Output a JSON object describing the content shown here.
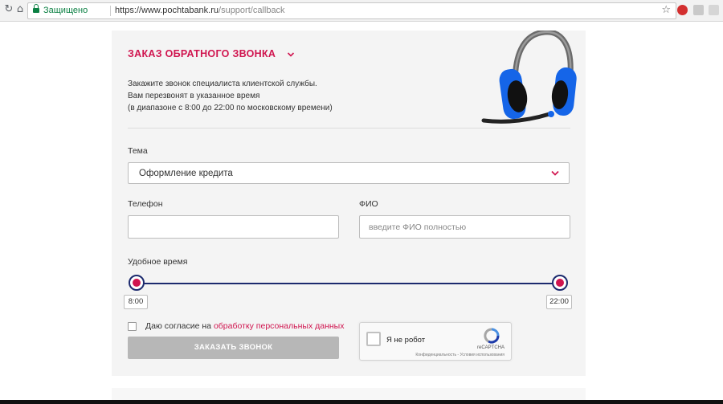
{
  "browser": {
    "secure_label": "Защищено",
    "url_host": "https://www.pochtabank.ru",
    "url_path": "/support/callback",
    "icons": [
      "back-arrow-icon",
      "home-icon",
      "star-icon",
      "extension-icons"
    ]
  },
  "form": {
    "title": "ЗАКАЗ ОБРАТНОГО ЗВОНКА",
    "description_lines": [
      "Закажите звонок специалиста клиентской службы.",
      "Вам перезвонят в указанное время",
      "(в диапазоне с 8:00 до 22:00 по московскому времени)"
    ],
    "topic": {
      "label": "Тема",
      "value": "Оформление кредита"
    },
    "phone": {
      "label": "Телефон",
      "value": "",
      "placeholder": ""
    },
    "fio": {
      "label": "ФИО",
      "value": "",
      "placeholder": "введите ФИО полностью"
    },
    "time": {
      "label": "Удобное время",
      "from": "8:00",
      "to": "22:00"
    },
    "consent": {
      "prefix": "Даю согласие на",
      "link": "обработку персональных данных",
      "checked": false
    },
    "submit_label": "ЗАКАЗАТЬ ЗВОНОК",
    "recaptcha": {
      "label": "Я не робот",
      "brand": "reCAPTCHA",
      "terms": "Конфиденциальность - Условия использования"
    }
  },
  "colors": {
    "accent": "#d0154f",
    "slider": "#1c2a6e",
    "secure": "#0b8043",
    "card_bg": "#f4f4f4",
    "button_disabled": "#b7b7b7"
  }
}
